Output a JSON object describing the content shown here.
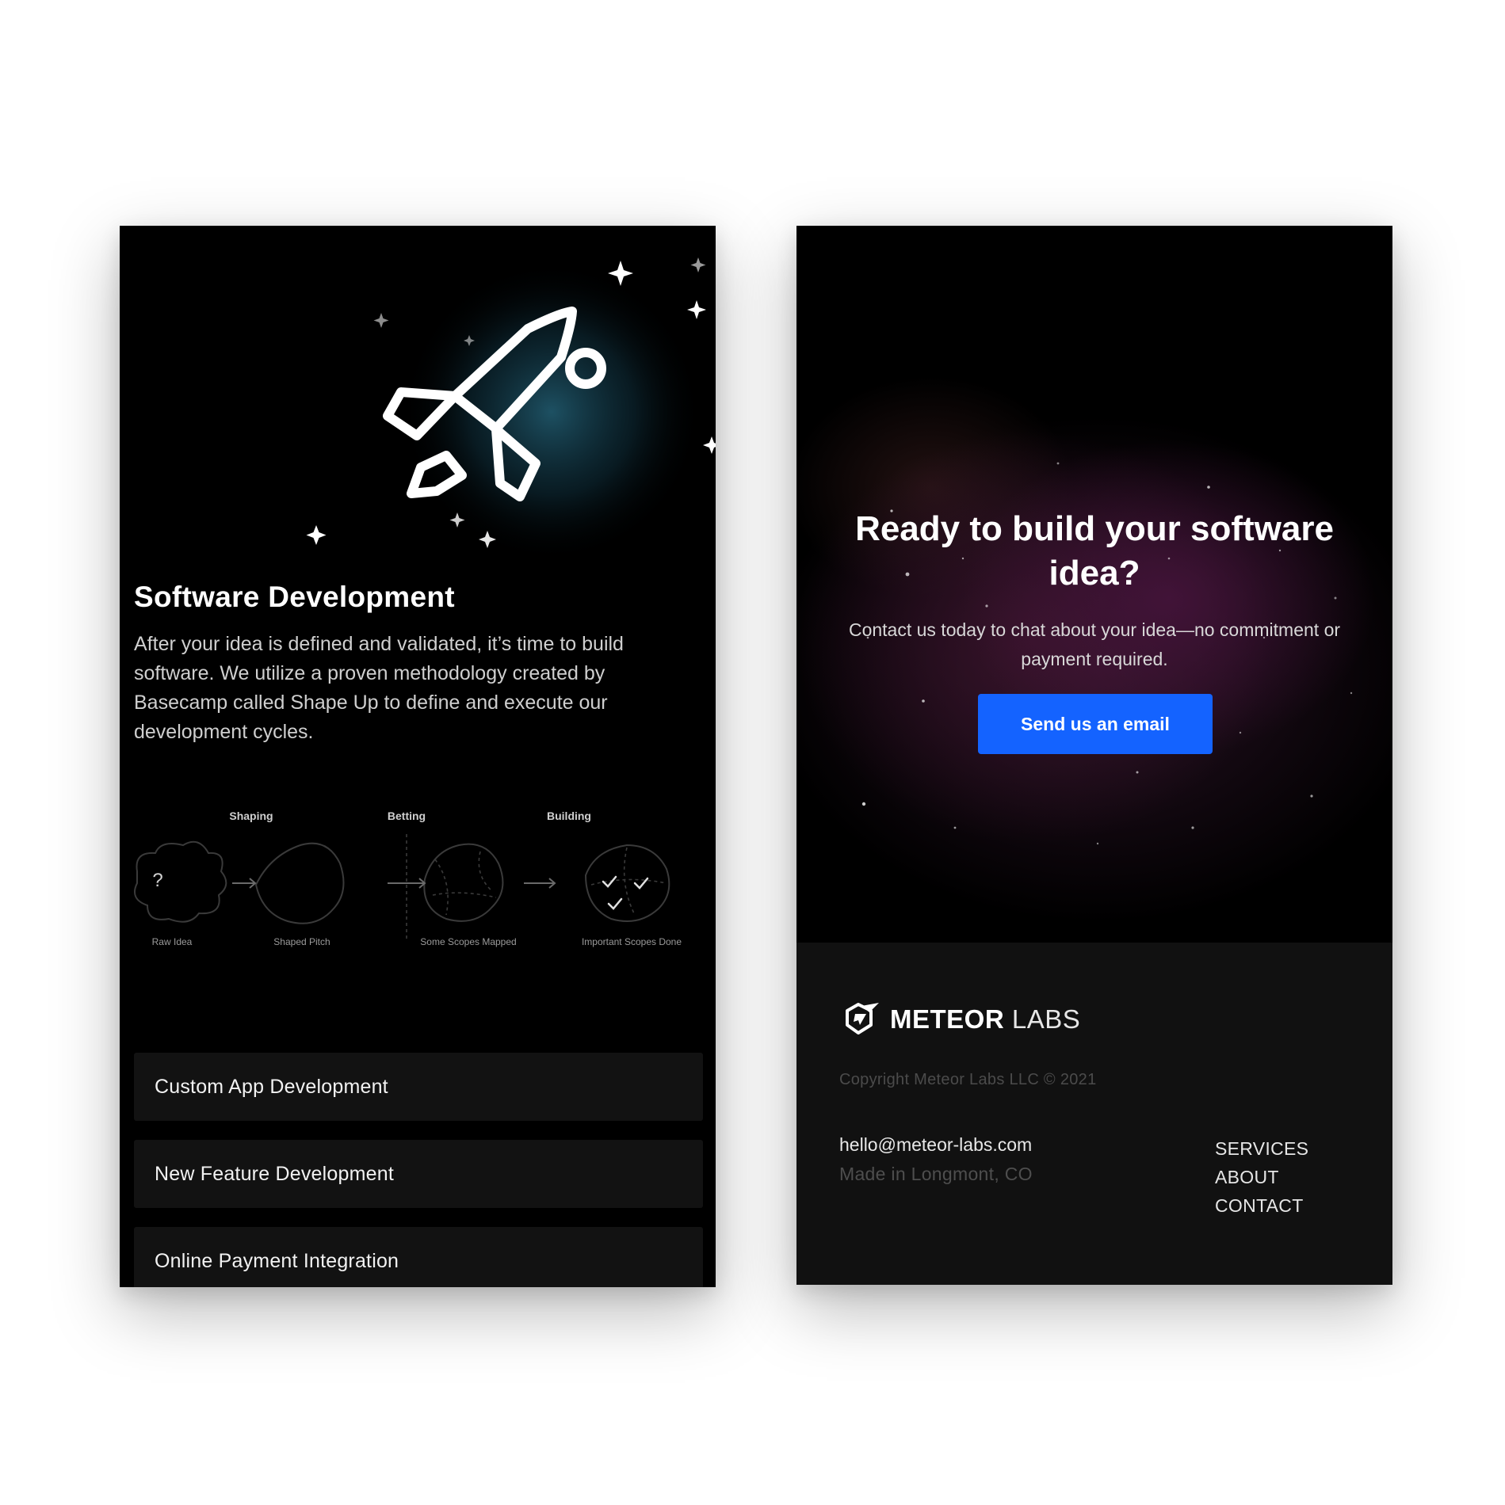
{
  "left_screen": {
    "title": "Software Development",
    "description": "After your idea is defined and validated, it’s time to build software. We utilize a proven methodology created by Basecamp called Shape Up to define and execute our development cycles.",
    "diagram": {
      "phases": [
        "Shaping",
        "Betting",
        "Building"
      ],
      "stages": [
        "Raw Idea",
        "Shaped Pitch",
        "Some Scopes Mapped",
        "Important Scopes Done"
      ],
      "question_mark": "?"
    },
    "services": [
      "Custom App Development",
      "New Feature Development",
      "Online Payment Integration"
    ]
  },
  "right_screen": {
    "cta": {
      "title": "Ready to build your software idea?",
      "subtitle": "Contact us today to chat about your idea—no commitment or payment required.",
      "button_label": "Send us an email"
    },
    "footer": {
      "logo_bold": "METEOR",
      "logo_light": "LABS",
      "copyright": "Copyright Meteor Labs LLC © 2021",
      "email": "hello@meteor-labs.com",
      "location": "Made in Longmont, CO",
      "nav": [
        "SERVICES",
        "ABOUT",
        "CONTACT"
      ]
    }
  },
  "colors": {
    "background": "#ffffff",
    "screen_bg": "#000000",
    "footer_bg": "#111111",
    "card_bg": "#121212",
    "button": "#1463ff",
    "rocket_glow": "#1c4a5c"
  },
  "icons": [
    "rocket-icon",
    "sparkle-icon",
    "meteor-logo-icon",
    "checkmark-icon",
    "arrow-right-icon"
  ]
}
